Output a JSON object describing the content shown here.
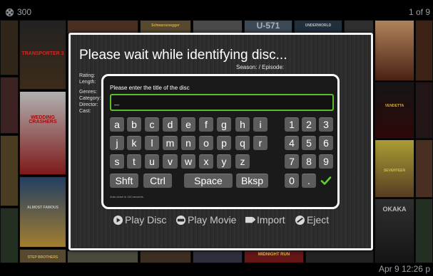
{
  "top_bar": {
    "item_count": "300",
    "page_indicator": "1 of 9",
    "reel_icon": "film-reel-icon"
  },
  "bottom_bar": {
    "clock": "Apr 9  12:26 p"
  },
  "posters": [
    {
      "label": "TRANSPORTER 3",
      "color": "#3a2a1a"
    },
    {
      "label": "WEDDING CRASHERS",
      "color": "#8a1010"
    },
    {
      "label": "ALMOST FAMOUS",
      "color": "#2a4d7a"
    },
    {
      "label": "STEP BROTHERS",
      "color": "#6a5a3a"
    },
    {
      "label": "Schwarzenegger",
      "color": "#5a4a3a"
    },
    {
      "label": "U-571",
      "color": "#4a5a6a"
    },
    {
      "label": "UNDERWORLD",
      "color": "#2a3a4a"
    },
    {
      "label": "VENDETTA",
      "color": "#3a0a0a"
    },
    {
      "label": "HIGHLANDER",
      "color": "#6a4a2a"
    },
    {
      "label": "OKAKA",
      "color": "#2a2a2a"
    },
    {
      "label": "MIDNIGHT RUN",
      "color": "#7a1a1a"
    },
    {
      "label": "SEVENTEEN",
      "color": "#7a6a1a"
    }
  ],
  "dialog": {
    "title": "Please wait while identifying disc...",
    "season_episode": "Season: / Episode:",
    "labels": [
      "Rating:",
      "Length:",
      "Genres:",
      "Category:",
      "Director:",
      "Cast:"
    ]
  },
  "keyboard": {
    "prompt": "Please enter the title of the disc",
    "input_value": "_",
    "rows": [
      [
        "a",
        "b",
        "c",
        "d",
        "e",
        "f",
        "g",
        "h",
        "i"
      ],
      [
        "j",
        "k",
        "l",
        "m",
        "n",
        "o",
        "p",
        "q",
        "r"
      ],
      [
        "s",
        "t",
        "u",
        "v",
        "w",
        "x",
        "y",
        "z"
      ]
    ],
    "digits": [
      [
        "1",
        "2",
        "3"
      ],
      [
        "4",
        "5",
        "6"
      ],
      [
        "7",
        "8",
        "9"
      ]
    ],
    "shift": "Shft",
    "ctrl": "Ctrl",
    "space": "Space",
    "backspace": "Bksp",
    "zero": "0",
    "dot": ".",
    "ok_icon": "checkmark-icon",
    "auto_close": "Auto-close in 116 seconds."
  },
  "actions": {
    "play_disc": "Play Disc",
    "play_movie": "Play Movie",
    "import": "Import",
    "eject": "Eject"
  },
  "colors": {
    "accent_green": "#5fd12e",
    "input_border": "#5bbf2a"
  }
}
